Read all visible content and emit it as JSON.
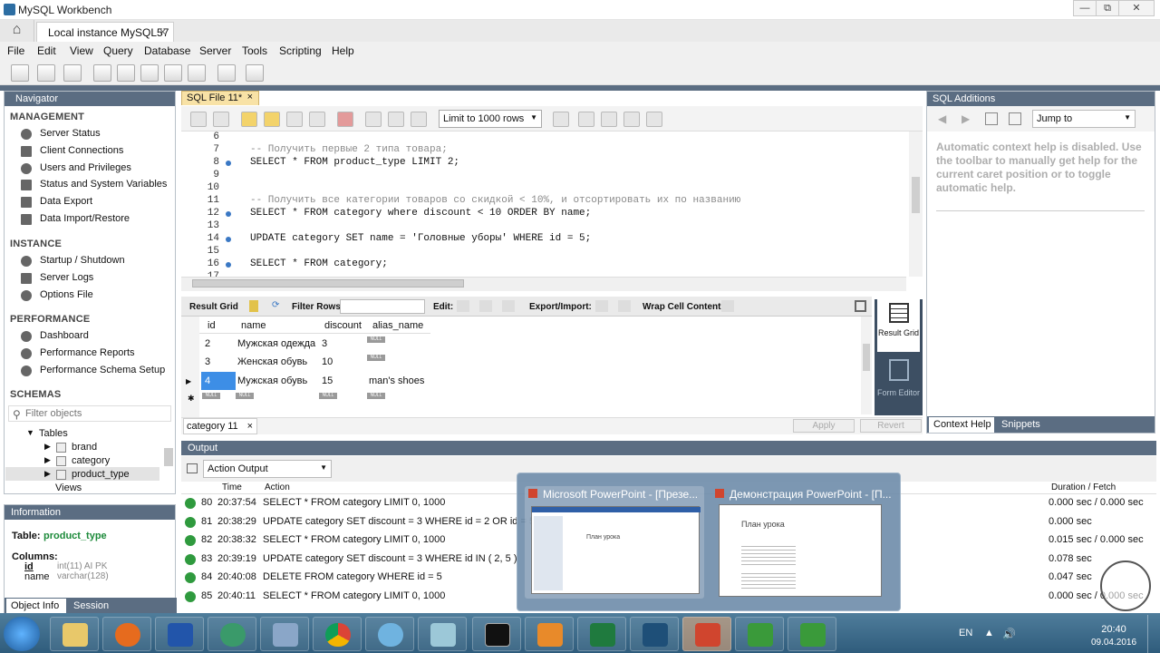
{
  "window": {
    "title": "MySQL Workbench",
    "min": "—",
    "max": "⧉",
    "close": "✕"
  },
  "tabs": {
    "home_icon": "home-icon",
    "connection": "Local instance MySQL57",
    "close": "×"
  },
  "menu": [
    "File",
    "Edit",
    "View",
    "Query",
    "Database",
    "Server",
    "Tools",
    "Scripting",
    "Help"
  ],
  "navigator": {
    "title": "Navigator",
    "management": {
      "label": "MANAGEMENT",
      "items": [
        "Server Status",
        "Client Connections",
        "Users and Privileges",
        "Status and System Variables",
        "Data Export",
        "Data Import/Restore"
      ]
    },
    "instance": {
      "label": "INSTANCE",
      "items": [
        "Startup / Shutdown",
        "Server Logs",
        "Options File"
      ]
    },
    "performance": {
      "label": "PERFORMANCE",
      "items": [
        "Dashboard",
        "Performance Reports",
        "Performance Schema Setup"
      ]
    },
    "schemas": {
      "label": "SCHEMAS",
      "filter_placeholder": "Filter objects",
      "tables_label": "Tables",
      "tables": [
        "brand",
        "category",
        "product_type"
      ],
      "views_label": "Views"
    }
  },
  "info": {
    "title": "Information",
    "table_label": "Table:",
    "table_name": "product_type",
    "columns_label": "Columns:",
    "columns": [
      {
        "name": "id",
        "type": "int(11) AI PK"
      },
      {
        "name": "name",
        "type": "varchar(128)"
      }
    ],
    "tabs": [
      "Object Info",
      "Session"
    ]
  },
  "editor": {
    "tab": "SQL File 11*",
    "tab_close": "×",
    "limit": "Limit to 1000 rows",
    "lines": [
      {
        "n": "6",
        "dot": false,
        "text": ""
      },
      {
        "n": "7",
        "dot": false,
        "text": "-- Получить первые 2 типа товара;",
        "cls": "cm"
      },
      {
        "n": "8",
        "dot": true,
        "text": "SELECT * FROM product_type LIMIT 2;"
      },
      {
        "n": "9",
        "dot": false,
        "text": ""
      },
      {
        "n": "10",
        "dot": false,
        "text": ""
      },
      {
        "n": "11",
        "dot": false,
        "text": "-- Получить все категории товаров со скидкой < 10%, и отсортировать их по названию",
        "cls": "cm"
      },
      {
        "n": "12",
        "dot": true,
        "text": "SELECT * FROM category where discount < 10 ORDER BY name;"
      },
      {
        "n": "13",
        "dot": false,
        "text": ""
      },
      {
        "n": "14",
        "dot": true,
        "text": "UPDATE category SET name = 'Головные уборы' WHERE id = 5;"
      },
      {
        "n": "15",
        "dot": false,
        "text": ""
      },
      {
        "n": "16",
        "dot": true,
        "text": "SELECT * FROM category;"
      },
      {
        "n": "17",
        "dot": false,
        "text": ""
      }
    ]
  },
  "result": {
    "result_grid": "Result Grid",
    "filter_rows": "Filter Rows:",
    "edit": "Edit:",
    "export_import": "Export/Import:",
    "wrap": "Wrap Cell Content:",
    "columns": [
      "id",
      "name",
      "discount",
      "alias_name"
    ],
    "rows": [
      {
        "id": "2",
        "name": "Мужская одежда",
        "discount": "3",
        "alias": "NULL"
      },
      {
        "id": "3",
        "name": "Женская обувь",
        "discount": "10",
        "alias": "NULL"
      },
      {
        "id": "4",
        "name": "Мужская обувь",
        "discount": "15",
        "alias": "man's shoes"
      }
    ],
    "null": "NULL",
    "result_tab": "category 11",
    "result_tab_close": "×",
    "apply": "Apply",
    "revert": "Revert",
    "side_result": "Result Grid",
    "side_form": "Form Editor"
  },
  "additions": {
    "title": "SQL Additions",
    "jump": "Jump to",
    "help": "Automatic context help is disabled. Use the toolbar to manually get help for the current caret position or to toggle automatic help.",
    "tabs": [
      "Context Help",
      "Snippets"
    ]
  },
  "output": {
    "title": "Output",
    "mode": "Action Output",
    "headers": [
      "Time",
      "Action",
      "Duration / Fetch"
    ],
    "rows": [
      {
        "n": "80",
        "time": "20:37:54",
        "action": "SELECT * FROM category LIMIT 0, 1000",
        "dur": "0.000 sec / 0.000 sec"
      },
      {
        "n": "81",
        "time": "20:38:29",
        "action": "UPDATE category SET discount = 3 WHERE id = 2 OR id = 5",
        "dur": "0.000 sec"
      },
      {
        "n": "82",
        "time": "20:38:32",
        "action": "SELECT * FROM category LIMIT 0, 1000",
        "dur": "0.015 sec / 0.000 sec"
      },
      {
        "n": "83",
        "time": "20:39:19",
        "action": "UPDATE category SET discount = 3 WHERE id IN ( 2, 5 )",
        "dur": "0.078 sec"
      },
      {
        "n": "84",
        "time": "20:40:08",
        "action": "DELETE FROM category WHERE id = 5",
        "dur": "0.047 sec"
      },
      {
        "n": "85",
        "time": "20:40:11",
        "action": "SELECT * FROM category LIMIT 0, 1000",
        "dur": "0.000 sec / 0.000 sec"
      }
    ]
  },
  "popup": {
    "left_title": "Microsoft PowerPoint - [Презе...",
    "right_title": "Демонстрация PowerPoint - [П...",
    "slide_title": "План урока"
  },
  "taskbar": {
    "lang": "EN",
    "time": "20:40",
    "date": "09.04.2016"
  }
}
